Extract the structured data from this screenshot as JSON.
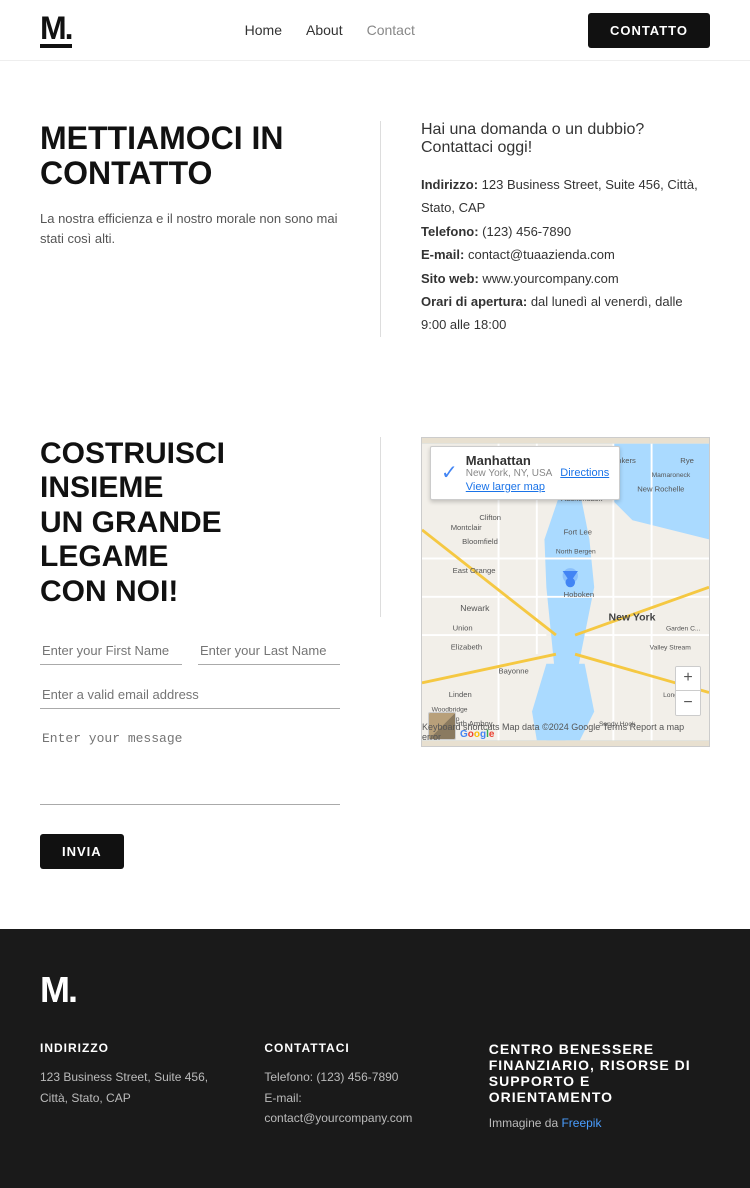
{
  "header": {
    "logo": "M.",
    "nav": {
      "home": "Home",
      "about": "About",
      "contact": "Contact"
    },
    "cta_button": "CONTATTO"
  },
  "section1": {
    "title_line1": "METTIAMOCI IN",
    "title_line2": "CONTATTO",
    "subtitle": "La nostra efficienza e il nostro morale non sono mai stati così alti.",
    "contact_intro": "Hai una domanda o un dubbio? Contattaci oggi!",
    "address_label": "Indirizzo:",
    "address_value": "123 Business Street, Suite 456, Città, Stato, CAP",
    "phone_label": "Telefono:",
    "phone_value": "(123) 456-7890",
    "email_label": "E-mail:",
    "email_value": "contact@tuaazienda.com",
    "web_label": "Sito web:",
    "web_value": "www.yourcompany.com",
    "hours_label": "Orari di apertura:",
    "hours_value": "dal lunedì al venerdì, dalle 9:00 alle 18:00"
  },
  "section2": {
    "title_line1": "COSTRUISCI INSIEME",
    "title_line2": "UN GRANDE LEGAME",
    "title_line3": "CON NOI!",
    "first_name_placeholder": "Enter your First Name",
    "last_name_placeholder": "Enter your Last Name",
    "email_placeholder": "Enter a valid email address",
    "message_placeholder": "Enter your message",
    "submit_label": "INVIA",
    "map": {
      "location": "Manhattan",
      "sublocation": "New York, NY, USA",
      "directions": "Directions",
      "view_larger": "View larger map",
      "footer": "Keyboard shortcuts  Map data ©2024 Google  Terms  Report a map error",
      "google": "Google"
    }
  },
  "footer": {
    "logo": "M.",
    "address_heading": "INDIRIZZO",
    "address_value": "123 Business Street, Suite 456, Città, Stato, CAP",
    "contact_heading": "CONTATTACI",
    "phone": "Telefono: (123) 456-7890",
    "email": "E-mail: contact@yourcompany.com",
    "right_heading": "Centro benessere finanziario, risorse di supporto e orientamento",
    "right_text": "Immagine da ",
    "right_link": "Freepik"
  }
}
